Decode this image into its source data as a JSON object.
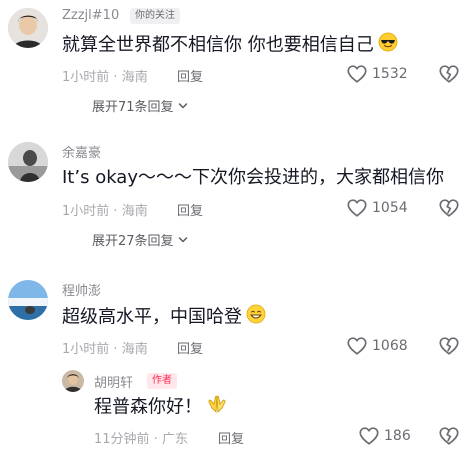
{
  "comments": [
    {
      "username": "Zzzjl#10",
      "tag": "你的关注",
      "text": "就算全世界都不相信你 你也要相信自己",
      "emoji": "sunglasses-emoji",
      "time": "1小时前",
      "location": "海南",
      "reply_label": "回复",
      "likes": "1532",
      "expand_label": "展开71条回复"
    },
    {
      "username": "余嘉豪",
      "text": "It’s okay～～～下次你会投进的，大家都相信你",
      "time": "1小时前",
      "location": "海南",
      "reply_label": "回复",
      "likes": "1054",
      "expand_label": "展开27条回复"
    },
    {
      "username": "程帅澎",
      "text": "超级高水平，中国哈登",
      "emoji": "grin-emoji",
      "time": "1小时前",
      "location": "海南",
      "reply_label": "回复",
      "likes": "1068"
    }
  ],
  "reply": {
    "username": "胡明轩",
    "tag": "作者",
    "text": "程普森你好！",
    "emoji": "praying-hands-emoji",
    "time": "11分钟前",
    "location": "广东",
    "reply_label": "回复",
    "likes": "186"
  },
  "separator": "·",
  "colors": {
    "text": "#161823",
    "meta": "#a8a9ae",
    "author_tag": "#fe2c55"
  }
}
